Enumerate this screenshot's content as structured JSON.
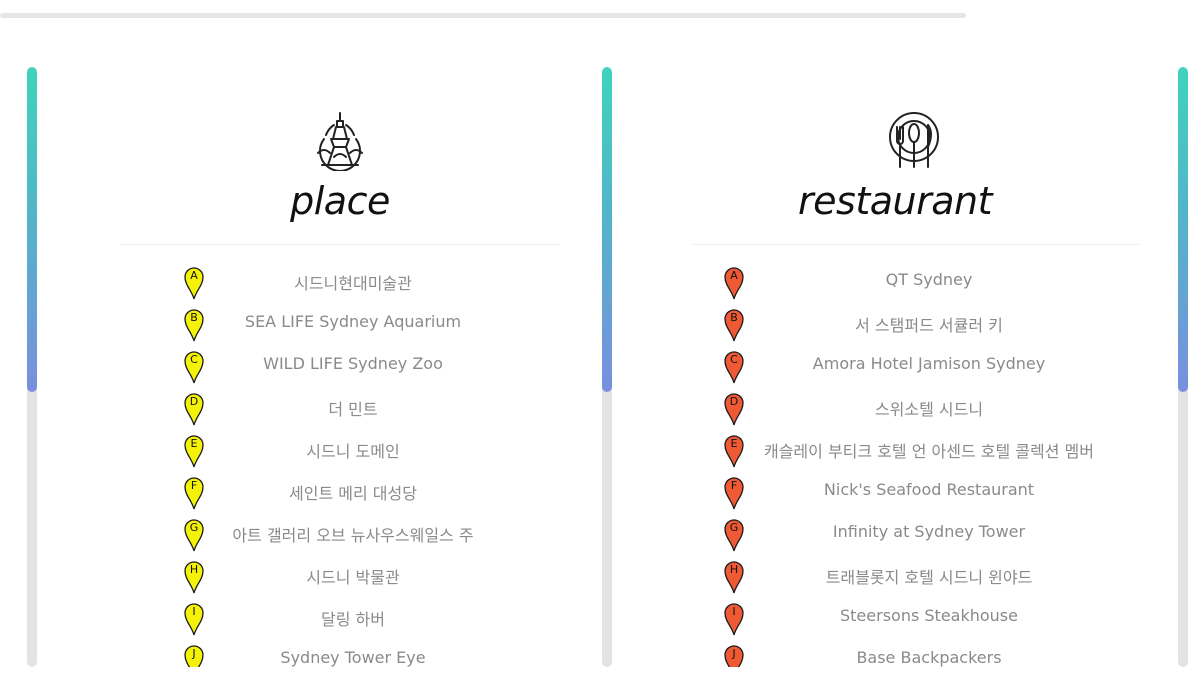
{
  "colors": {
    "place_marker": "#f5f20a",
    "restaurant_marker": "#ef5a35",
    "scroll_gradient_top": "#3fd3bd",
    "scroll_gradient_bottom": "#7a8fde"
  },
  "place": {
    "title": "place",
    "icon": "eiffel-tower-icon",
    "items": [
      {
        "marker": "A",
        "name": "시드니현대미술관"
      },
      {
        "marker": "B",
        "name": "SEA LIFE Sydney Aquarium"
      },
      {
        "marker": "C",
        "name": "WILD LIFE Sydney Zoo"
      },
      {
        "marker": "D",
        "name": "더 민트"
      },
      {
        "marker": "E",
        "name": "시드니 도메인"
      },
      {
        "marker": "F",
        "name": "세인트 메리 대성당"
      },
      {
        "marker": "G",
        "name": "아트 갤러리 오브 뉴사우스웨일스 주"
      },
      {
        "marker": "H",
        "name": "시드니 박물관"
      },
      {
        "marker": "I",
        "name": "달링 하버"
      },
      {
        "marker": "J",
        "name": "Sydney Tower Eye"
      }
    ]
  },
  "restaurant": {
    "title": "restaurant",
    "icon": "plate-fork-knife-icon",
    "items": [
      {
        "marker": "A",
        "name": "QT Sydney"
      },
      {
        "marker": "B",
        "name": "서 스탬퍼드 서큘러 키"
      },
      {
        "marker": "C",
        "name": "Amora Hotel Jamison Sydney"
      },
      {
        "marker": "D",
        "name": "스위소텔 시드니"
      },
      {
        "marker": "E",
        "name": "캐슬레이 부티크 호텔 언 아센드 호텔 콜렉션 멤버"
      },
      {
        "marker": "F",
        "name": "Nick's Seafood Restaurant"
      },
      {
        "marker": "G",
        "name": "Infinity at Sydney Tower"
      },
      {
        "marker": "H",
        "name": "트래블롯지 호텔 시드니 윈야드"
      },
      {
        "marker": "I",
        "name": "Steersons Steakhouse"
      },
      {
        "marker": "J",
        "name": "Base Backpackers"
      }
    ]
  }
}
